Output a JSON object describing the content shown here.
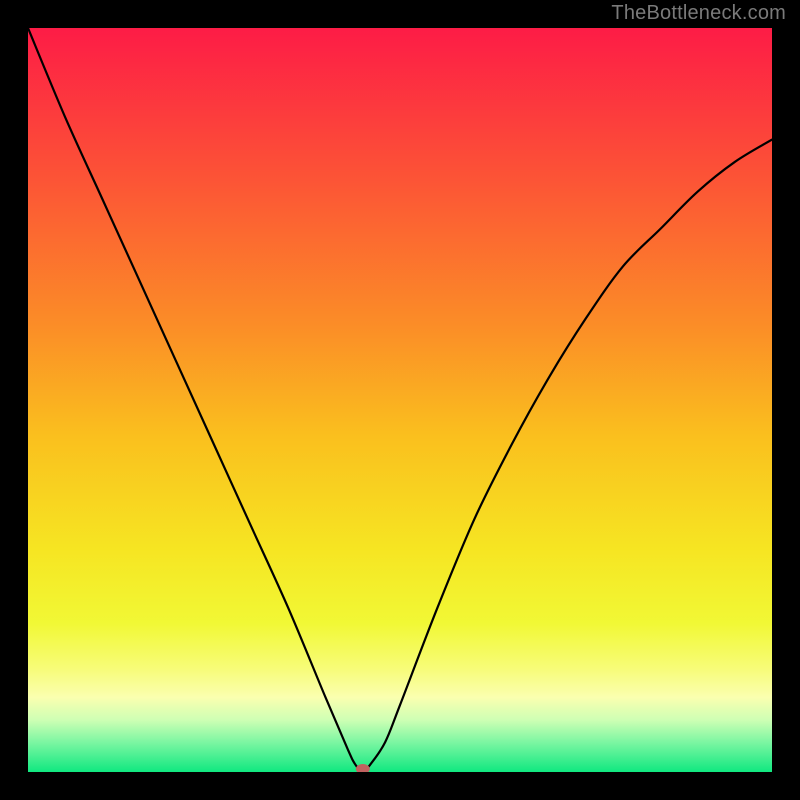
{
  "watermark": "TheBottleneck.com",
  "chart_data": {
    "type": "line",
    "title": "",
    "xlabel": "",
    "ylabel": "",
    "xlim": [
      0,
      100
    ],
    "ylim": [
      0,
      100
    ],
    "grid": false,
    "legend": false,
    "series": [
      {
        "name": "curve",
        "x": [
          0,
          5,
          10,
          15,
          20,
          25,
          30,
          35,
          40,
          43,
          44,
          45,
          46,
          48,
          50,
          55,
          60,
          65,
          70,
          75,
          80,
          85,
          90,
          95,
          100
        ],
        "y": [
          100,
          88,
          77,
          66,
          55,
          44,
          33,
          22,
          10,
          3,
          1,
          0,
          1,
          4,
          9,
          22,
          34,
          44,
          53,
          61,
          68,
          73,
          78,
          82,
          85
        ]
      }
    ],
    "marker": {
      "x": 45,
      "y": 0,
      "color": "#c0615f"
    },
    "background_gradient": {
      "stops": [
        {
          "offset": 0.0,
          "color": "#fd1c46"
        },
        {
          "offset": 0.2,
          "color": "#fc5336"
        },
        {
          "offset": 0.4,
          "color": "#fb8d27"
        },
        {
          "offset": 0.55,
          "color": "#fac01e"
        },
        {
          "offset": 0.7,
          "color": "#f6e522"
        },
        {
          "offset": 0.8,
          "color": "#f1f835"
        },
        {
          "offset": 0.86,
          "color": "#f7fc77"
        },
        {
          "offset": 0.9,
          "color": "#faffb0"
        },
        {
          "offset": 0.93,
          "color": "#ceffb4"
        },
        {
          "offset": 0.96,
          "color": "#7cf6a2"
        },
        {
          "offset": 1.0,
          "color": "#10e880"
        }
      ]
    }
  }
}
